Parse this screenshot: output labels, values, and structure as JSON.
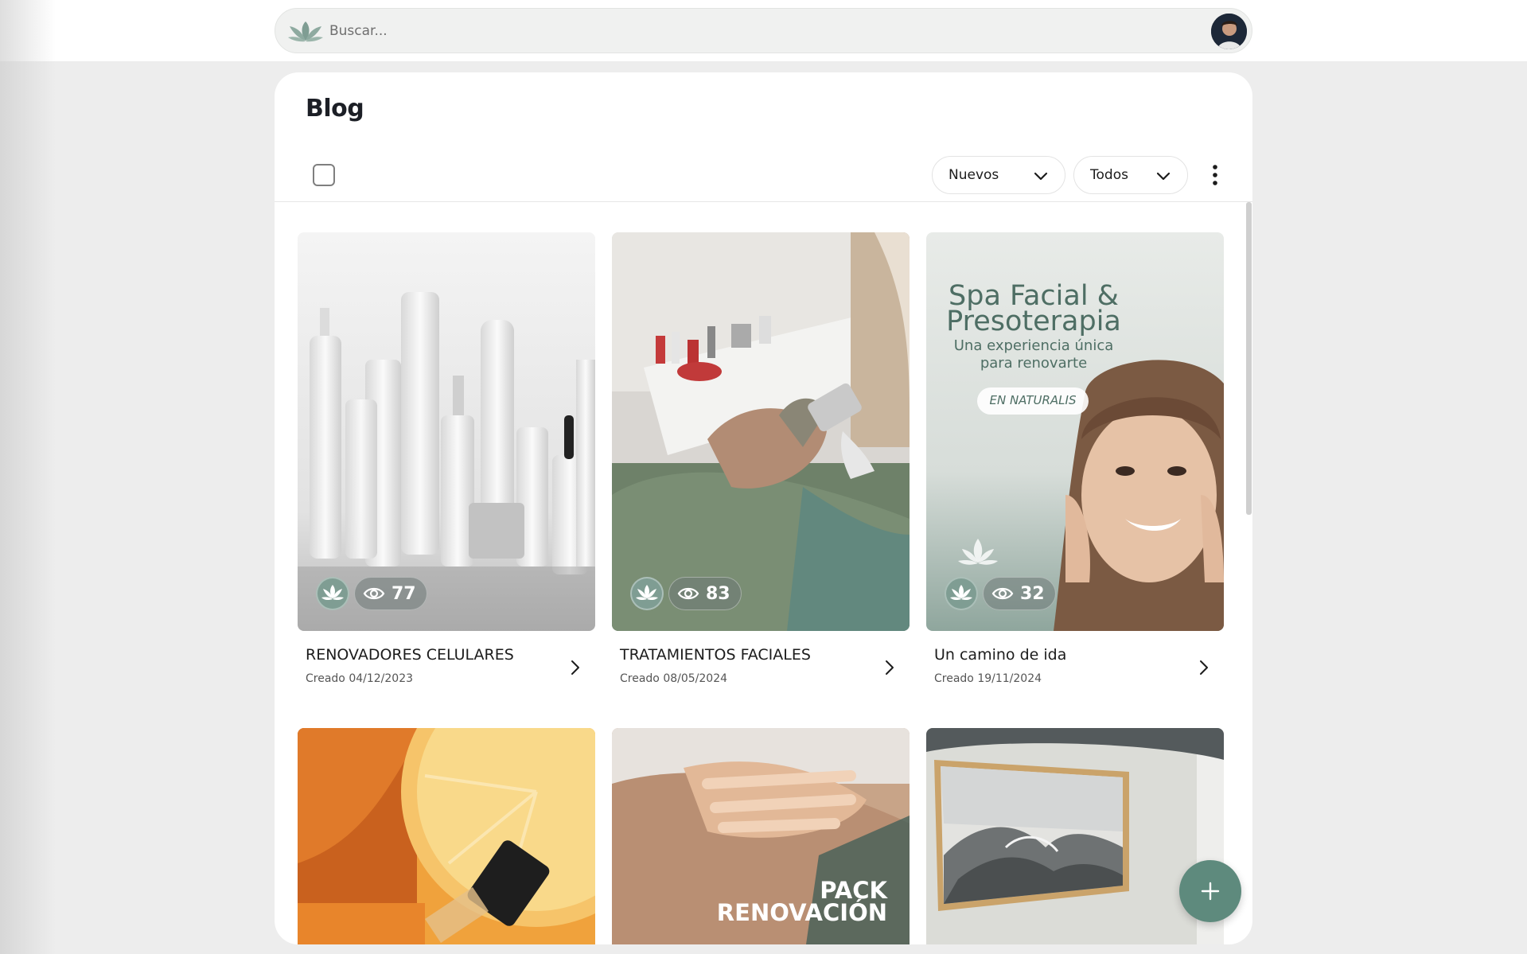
{
  "search": {
    "placeholder": "Buscar..."
  },
  "page": {
    "title": "Blog"
  },
  "toolbar": {
    "sort_label": "Nuevos",
    "filter_label": "Todos"
  },
  "cards": [
    {
      "title": "RENOVADORES CELULARES",
      "date": "Creado 04/12/2023",
      "views": "77"
    },
    {
      "title": "TRATAMIENTOS FACIALES",
      "date": "Creado 08/05/2024",
      "views": "83"
    },
    {
      "title": "Un camino de ida",
      "date": "Creado 19/11/2024",
      "views": "32"
    }
  ],
  "card3_image_text": {
    "heading1": "Spa Facial &",
    "heading2": "Presoterapia",
    "sub1": "Una experiencia única",
    "sub2": "para renovarte",
    "tag": "EN NATURALIS"
  },
  "card5_image_text": {
    "line1": "PACK",
    "line2": "RENOVACIÓN"
  },
  "colors": {
    "accent": "#5e8a7d",
    "badge": "#7f9d93",
    "title": "#1c1f26"
  },
  "icons": [
    "lotus-logo-icon",
    "eye-icon",
    "chevron-down-icon",
    "chevron-right-icon",
    "kebab-menu-icon",
    "plus-icon"
  ]
}
